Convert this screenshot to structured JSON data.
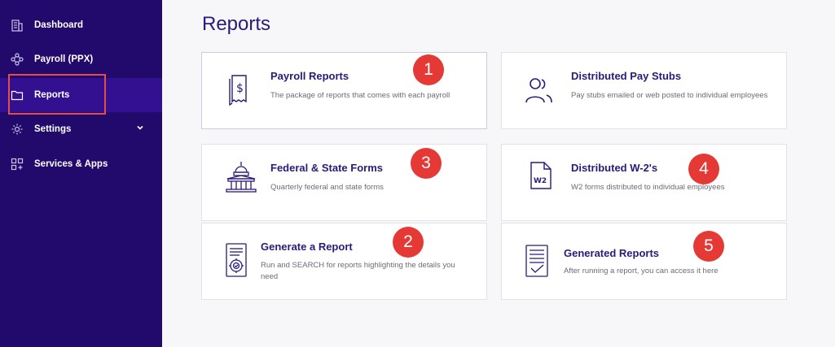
{
  "sidebar": {
    "items": [
      {
        "label": "Dashboard",
        "icon": "building-icon"
      },
      {
        "label": "Payroll (PPX)",
        "icon": "network-icon"
      },
      {
        "label": "Reports",
        "icon": "folder-icon",
        "active": true
      },
      {
        "label": "Settings",
        "icon": "gear-icon"
      },
      {
        "label": "Services & Apps",
        "icon": "apps-icon"
      }
    ]
  },
  "page": {
    "title": "Reports"
  },
  "cards": [
    {
      "title": "Payroll Reports",
      "description": "The package of reports that comes with each payroll",
      "icon": "receipt-dollar-icon",
      "badge": "1"
    },
    {
      "title": "Distributed Pay Stubs",
      "description": "Pay stubs emailed or web posted to individual employees",
      "icon": "users-icon"
    },
    {
      "title": "Federal & State Forms",
      "description": "Quarterly federal and state forms",
      "icon": "capitol-building-icon",
      "badge": "3"
    },
    {
      "title": "Distributed W-2's",
      "description": "W2 forms distributed to individual employees",
      "icon": "w2-document-icon",
      "icon_text": "W2",
      "badge": "4"
    },
    {
      "title": "Generate a Report",
      "description": "Run and SEARCH for reports highlighting the details you need",
      "icon": "report-gear-icon",
      "badge": "2"
    },
    {
      "title": "Generated Reports",
      "description": "After running a report, you can access it here",
      "icon": "report-check-icon",
      "badge": "5"
    }
  ],
  "colors": {
    "sidebar_bg": "#210a6b",
    "sidebar_active": "#33108f",
    "accent": "#2a1a7a",
    "badge": "#e53935",
    "highlight_border": "#e84b4b"
  }
}
